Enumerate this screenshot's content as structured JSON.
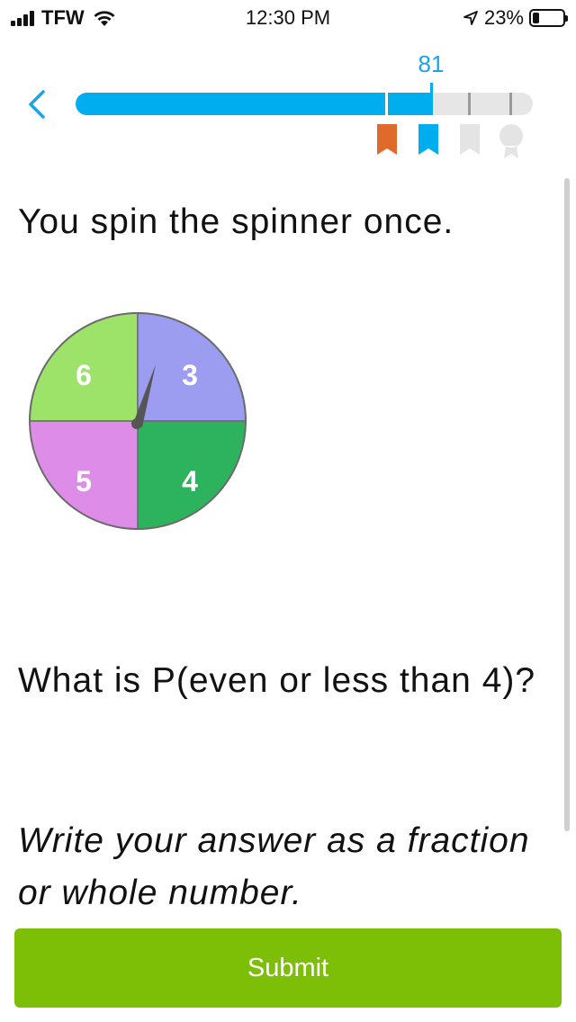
{
  "status_bar": {
    "carrier": "TFW",
    "time": "12:30 PM",
    "battery_percent": "23%",
    "battery_level": 0.23
  },
  "progress": {
    "score": "81",
    "fraction": 0.81,
    "bar_color": "#00aeef",
    "awards": [
      {
        "name": "orange-ribbon",
        "color": "#e06a2c",
        "earned": true
      },
      {
        "name": "blue-ribbon",
        "color": "#00aeef",
        "earned": true
      },
      {
        "name": "gray-ribbon",
        "color": "#e4e4e4",
        "earned": false
      },
      {
        "name": "gray-medal",
        "color": "#e4e4e4",
        "earned": false
      }
    ]
  },
  "question": {
    "intro": "You spin the spinner once.",
    "prompt": "What is P(even or less than 4)?",
    "instruction": "Write your answer as a fraction or whole number."
  },
  "spinner": {
    "sections": [
      {
        "label": "6",
        "color": "#9de36a"
      },
      {
        "label": "3",
        "color": "#9c9cf0"
      },
      {
        "label": "4",
        "color": "#2db35d"
      },
      {
        "label": "5",
        "color": "#dd8de8"
      }
    ],
    "pointer_color": "#555555"
  },
  "submit_label": "Submit",
  "accent": "#7cbf06"
}
